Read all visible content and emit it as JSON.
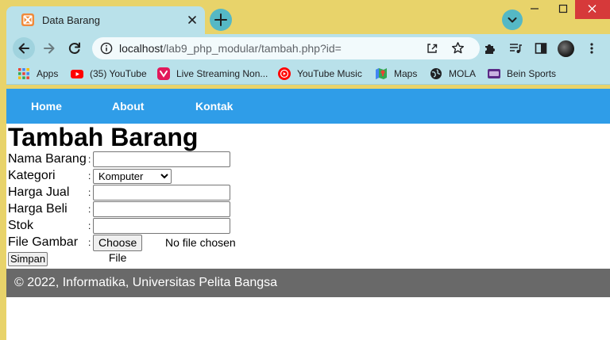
{
  "browser": {
    "tab": {
      "title": "Data Barang",
      "favicon": "xampp-icon"
    },
    "url": {
      "host": "localhost",
      "path": "/lab9_php_modular/tambah.php?id="
    },
    "bookmarks": [
      {
        "label": "Apps",
        "icon": "apps-grid-icon"
      },
      {
        "label": "(35) YouTube",
        "icon": "youtube-icon"
      },
      {
        "label": "Live Streaming Non...",
        "icon": "vidio-icon"
      },
      {
        "label": "YouTube Music",
        "icon": "youtube-music-icon"
      },
      {
        "label": "Maps",
        "icon": "maps-icon"
      },
      {
        "label": "MOLA",
        "icon": "globe-icon"
      },
      {
        "label": "Bein Sports",
        "icon": "bein-icon"
      }
    ]
  },
  "nav": {
    "items": [
      "Home",
      "About",
      "Kontak"
    ]
  },
  "form": {
    "heading": "Tambah Barang",
    "separator": ":",
    "fields": {
      "nama": {
        "label": "Nama Barang",
        "value": ""
      },
      "kategori": {
        "label": "Kategori",
        "selected": "Komputer"
      },
      "harga_jual": {
        "label": "Harga Jual",
        "value": ""
      },
      "harga_beli": {
        "label": "Harga Beli",
        "value": ""
      },
      "stok": {
        "label": "Stok",
        "value": ""
      },
      "gambar": {
        "label": "File Gambar",
        "button": "Choose File",
        "status": "No file chosen"
      }
    },
    "submit_label": "Simpan"
  },
  "footer": {
    "text": "© 2022, Informatika, Universitas Pelita Bangsa"
  },
  "colors": {
    "chrome_frame": "#e8d36a",
    "chrome_toolbar": "#b9e1ea",
    "nav_bar": "#2f9de8",
    "footer": "#696969",
    "close_button": "#d6393a"
  }
}
